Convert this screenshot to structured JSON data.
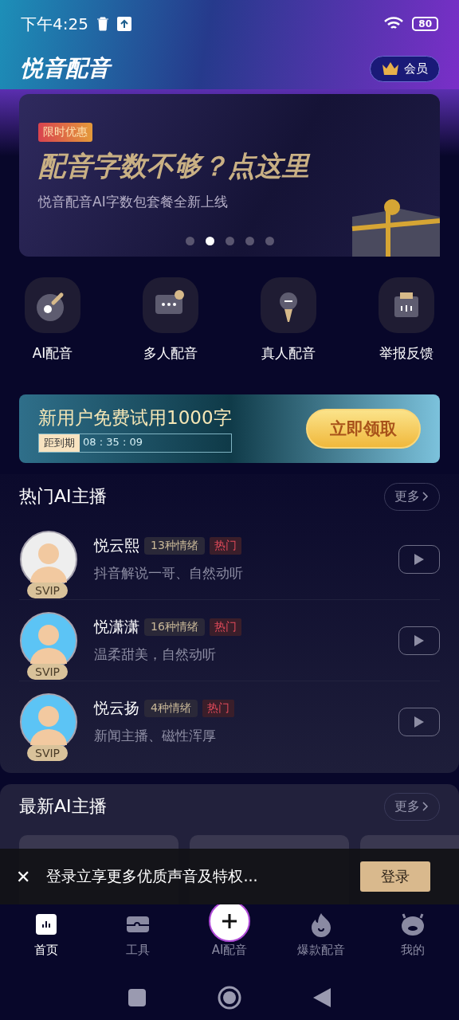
{
  "status_bar": {
    "time": "下午4:25",
    "battery": "80"
  },
  "header": {
    "title": "悦音配音",
    "vip_button": "会员"
  },
  "banner": {
    "tag": "限时优惠",
    "headline": "配音字数不够？点这里",
    "subtitle": "悦音配音AI字数包套餐全新上线",
    "dots": [
      {
        "selected": false
      },
      {
        "selected": true
      },
      {
        "selected": false
      },
      {
        "selected": false
      },
      {
        "selected": false
      }
    ]
  },
  "shortcuts": [
    {
      "kind": "disc",
      "label": "AI配音"
    },
    {
      "kind": "chat",
      "label": "多人配音"
    },
    {
      "kind": "mic",
      "label": "真人配音"
    },
    {
      "kind": "report",
      "label": "举报反馈"
    }
  ],
  "promo": {
    "title": "新用户免费试用1000字",
    "countdown_label": "距到期",
    "hours": "08",
    "minutes": "35",
    "seconds": "09",
    "separator": ":",
    "button": "立即领取"
  },
  "hot_section": {
    "title": "热门AI主播",
    "more": "更多",
    "anchors": [
      {
        "name": "悦云熙",
        "emotions": "13种情绪",
        "tag": "热门",
        "description": "抖音解说一哥、自然动听",
        "badge": "SVIP",
        "color": "#eeeeee"
      },
      {
        "name": "悦潇潇",
        "emotions": "16种情绪",
        "tag": "热门",
        "description": "温柔甜美，自然动听",
        "badge": "SVIP",
        "color": "#5cc4f5"
      },
      {
        "name": "悦云扬",
        "emotions": "4种情绪",
        "tag": "热门",
        "description": "新闻主播、磁性浑厚",
        "badge": "SVIP",
        "color": "#5cc4f5"
      }
    ]
  },
  "new_section": {
    "title": "最新AI主播",
    "more": "更多"
  },
  "login_bar": {
    "close": "✕",
    "message": "登录立享更多优质声音及特权...",
    "button": "登录"
  },
  "bottom_nav": [
    {
      "kind": "home",
      "label": "首页",
      "selected": true
    },
    {
      "kind": "tools",
      "label": "工具",
      "selected": false
    },
    {
      "kind": "plus",
      "label": "AI配音",
      "selected": false
    },
    {
      "kind": "fire",
      "label": "爆款配音",
      "selected": false
    },
    {
      "kind": "robot",
      "label": "我的",
      "selected": false
    }
  ]
}
